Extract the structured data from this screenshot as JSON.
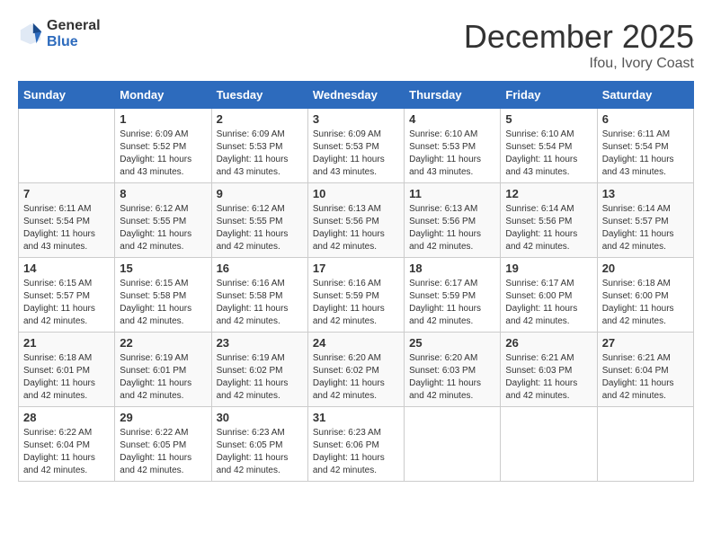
{
  "header": {
    "logo_general": "General",
    "logo_blue": "Blue",
    "month_year": "December 2025",
    "location": "Ifou, Ivory Coast"
  },
  "days_of_week": [
    "Sunday",
    "Monday",
    "Tuesday",
    "Wednesday",
    "Thursday",
    "Friday",
    "Saturday"
  ],
  "weeks": [
    [
      {
        "day": "",
        "sunrise": "",
        "sunset": "",
        "daylight": ""
      },
      {
        "day": "1",
        "sunrise": "Sunrise: 6:09 AM",
        "sunset": "Sunset: 5:52 PM",
        "daylight": "Daylight: 11 hours and 43 minutes."
      },
      {
        "day": "2",
        "sunrise": "Sunrise: 6:09 AM",
        "sunset": "Sunset: 5:53 PM",
        "daylight": "Daylight: 11 hours and 43 minutes."
      },
      {
        "day": "3",
        "sunrise": "Sunrise: 6:09 AM",
        "sunset": "Sunset: 5:53 PM",
        "daylight": "Daylight: 11 hours and 43 minutes."
      },
      {
        "day": "4",
        "sunrise": "Sunrise: 6:10 AM",
        "sunset": "Sunset: 5:53 PM",
        "daylight": "Daylight: 11 hours and 43 minutes."
      },
      {
        "day": "5",
        "sunrise": "Sunrise: 6:10 AM",
        "sunset": "Sunset: 5:54 PM",
        "daylight": "Daylight: 11 hours and 43 minutes."
      },
      {
        "day": "6",
        "sunrise": "Sunrise: 6:11 AM",
        "sunset": "Sunset: 5:54 PM",
        "daylight": "Daylight: 11 hours and 43 minutes."
      }
    ],
    [
      {
        "day": "7",
        "sunrise": "Sunrise: 6:11 AM",
        "sunset": "Sunset: 5:54 PM",
        "daylight": "Daylight: 11 hours and 43 minutes."
      },
      {
        "day": "8",
        "sunrise": "Sunrise: 6:12 AM",
        "sunset": "Sunset: 5:55 PM",
        "daylight": "Daylight: 11 hours and 42 minutes."
      },
      {
        "day": "9",
        "sunrise": "Sunrise: 6:12 AM",
        "sunset": "Sunset: 5:55 PM",
        "daylight": "Daylight: 11 hours and 42 minutes."
      },
      {
        "day": "10",
        "sunrise": "Sunrise: 6:13 AM",
        "sunset": "Sunset: 5:56 PM",
        "daylight": "Daylight: 11 hours and 42 minutes."
      },
      {
        "day": "11",
        "sunrise": "Sunrise: 6:13 AM",
        "sunset": "Sunset: 5:56 PM",
        "daylight": "Daylight: 11 hours and 42 minutes."
      },
      {
        "day": "12",
        "sunrise": "Sunrise: 6:14 AM",
        "sunset": "Sunset: 5:56 PM",
        "daylight": "Daylight: 11 hours and 42 minutes."
      },
      {
        "day": "13",
        "sunrise": "Sunrise: 6:14 AM",
        "sunset": "Sunset: 5:57 PM",
        "daylight": "Daylight: 11 hours and 42 minutes."
      }
    ],
    [
      {
        "day": "14",
        "sunrise": "Sunrise: 6:15 AM",
        "sunset": "Sunset: 5:57 PM",
        "daylight": "Daylight: 11 hours and 42 minutes."
      },
      {
        "day": "15",
        "sunrise": "Sunrise: 6:15 AM",
        "sunset": "Sunset: 5:58 PM",
        "daylight": "Daylight: 11 hours and 42 minutes."
      },
      {
        "day": "16",
        "sunrise": "Sunrise: 6:16 AM",
        "sunset": "Sunset: 5:58 PM",
        "daylight": "Daylight: 11 hours and 42 minutes."
      },
      {
        "day": "17",
        "sunrise": "Sunrise: 6:16 AM",
        "sunset": "Sunset: 5:59 PM",
        "daylight": "Daylight: 11 hours and 42 minutes."
      },
      {
        "day": "18",
        "sunrise": "Sunrise: 6:17 AM",
        "sunset": "Sunset: 5:59 PM",
        "daylight": "Daylight: 11 hours and 42 minutes."
      },
      {
        "day": "19",
        "sunrise": "Sunrise: 6:17 AM",
        "sunset": "Sunset: 6:00 PM",
        "daylight": "Daylight: 11 hours and 42 minutes."
      },
      {
        "day": "20",
        "sunrise": "Sunrise: 6:18 AM",
        "sunset": "Sunset: 6:00 PM",
        "daylight": "Daylight: 11 hours and 42 minutes."
      }
    ],
    [
      {
        "day": "21",
        "sunrise": "Sunrise: 6:18 AM",
        "sunset": "Sunset: 6:01 PM",
        "daylight": "Daylight: 11 hours and 42 minutes."
      },
      {
        "day": "22",
        "sunrise": "Sunrise: 6:19 AM",
        "sunset": "Sunset: 6:01 PM",
        "daylight": "Daylight: 11 hours and 42 minutes."
      },
      {
        "day": "23",
        "sunrise": "Sunrise: 6:19 AM",
        "sunset": "Sunset: 6:02 PM",
        "daylight": "Daylight: 11 hours and 42 minutes."
      },
      {
        "day": "24",
        "sunrise": "Sunrise: 6:20 AM",
        "sunset": "Sunset: 6:02 PM",
        "daylight": "Daylight: 11 hours and 42 minutes."
      },
      {
        "day": "25",
        "sunrise": "Sunrise: 6:20 AM",
        "sunset": "Sunset: 6:03 PM",
        "daylight": "Daylight: 11 hours and 42 minutes."
      },
      {
        "day": "26",
        "sunrise": "Sunrise: 6:21 AM",
        "sunset": "Sunset: 6:03 PM",
        "daylight": "Daylight: 11 hours and 42 minutes."
      },
      {
        "day": "27",
        "sunrise": "Sunrise: 6:21 AM",
        "sunset": "Sunset: 6:04 PM",
        "daylight": "Daylight: 11 hours and 42 minutes."
      }
    ],
    [
      {
        "day": "28",
        "sunrise": "Sunrise: 6:22 AM",
        "sunset": "Sunset: 6:04 PM",
        "daylight": "Daylight: 11 hours and 42 minutes."
      },
      {
        "day": "29",
        "sunrise": "Sunrise: 6:22 AM",
        "sunset": "Sunset: 6:05 PM",
        "daylight": "Daylight: 11 hours and 42 minutes."
      },
      {
        "day": "30",
        "sunrise": "Sunrise: 6:23 AM",
        "sunset": "Sunset: 6:05 PM",
        "daylight": "Daylight: 11 hours and 42 minutes."
      },
      {
        "day": "31",
        "sunrise": "Sunrise: 6:23 AM",
        "sunset": "Sunset: 6:06 PM",
        "daylight": "Daylight: 11 hours and 42 minutes."
      },
      {
        "day": "",
        "sunrise": "",
        "sunset": "",
        "daylight": ""
      },
      {
        "day": "",
        "sunrise": "",
        "sunset": "",
        "daylight": ""
      },
      {
        "day": "",
        "sunrise": "",
        "sunset": "",
        "daylight": ""
      }
    ]
  ]
}
